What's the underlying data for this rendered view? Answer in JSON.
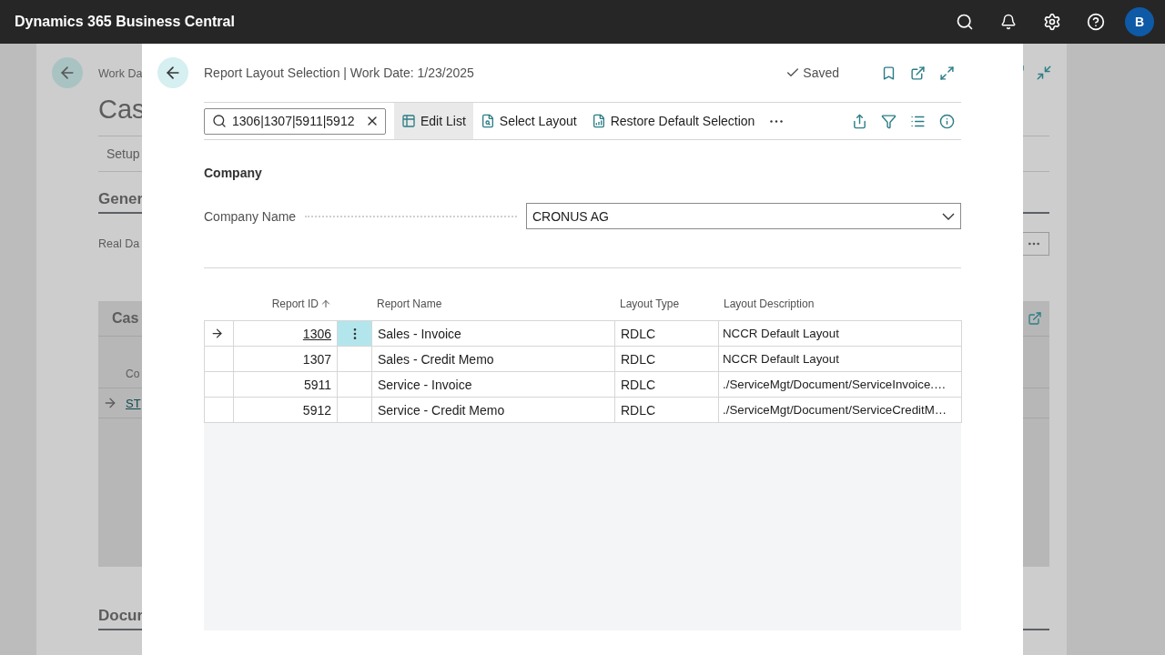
{
  "top_bar": {
    "title": "Dynamics 365 Business Central",
    "user_initial": "B"
  },
  "background_page": {
    "caption": "Work Da",
    "title": "Cas",
    "tab": "Setup",
    "section": "Gener",
    "field_label": "Real Da",
    "part_title": "Cas",
    "column": "Co",
    "row_link": "ST",
    "lower_section": "Docur"
  },
  "dialog": {
    "title": "Report Layout Selection | Work Date: 1/23/2025",
    "status": "Saved",
    "search": {
      "value": "1306|1307|5911|5912"
    },
    "actions": [
      {
        "label": "Edit List",
        "kind": "edit",
        "selected": true
      },
      {
        "label": "Select Layout",
        "kind": "select",
        "selected": false
      },
      {
        "label": "Restore Default Selection",
        "kind": "restore",
        "selected": false
      }
    ],
    "section": "Company",
    "company_name": {
      "label": "Company Name",
      "value": "CRONUS AG"
    },
    "table": {
      "columns": [
        "Report ID",
        "Report Name",
        "Layout Type",
        "Layout Description"
      ],
      "rows": [
        {
          "report_id": "1306",
          "report_name": "Sales - Invoice",
          "layout_type": "RDLC",
          "layout_description": "NCCR Default Layout",
          "selected": true
        },
        {
          "report_id": "1307",
          "report_name": "Sales - Credit Memo",
          "layout_type": "RDLC",
          "layout_description": "NCCR Default Layout",
          "selected": false
        },
        {
          "report_id": "5911",
          "report_name": "Service - Invoice",
          "layout_type": "RDLC",
          "layout_description": "./ServiceMgt/Document/ServiceInvoice.…",
          "selected": false
        },
        {
          "report_id": "5912",
          "report_name": "Service - Credit Memo",
          "layout_type": "RDLC",
          "layout_description": "./ServiceMgt/Document/ServiceCreditM…",
          "selected": false
        }
      ]
    }
  }
}
